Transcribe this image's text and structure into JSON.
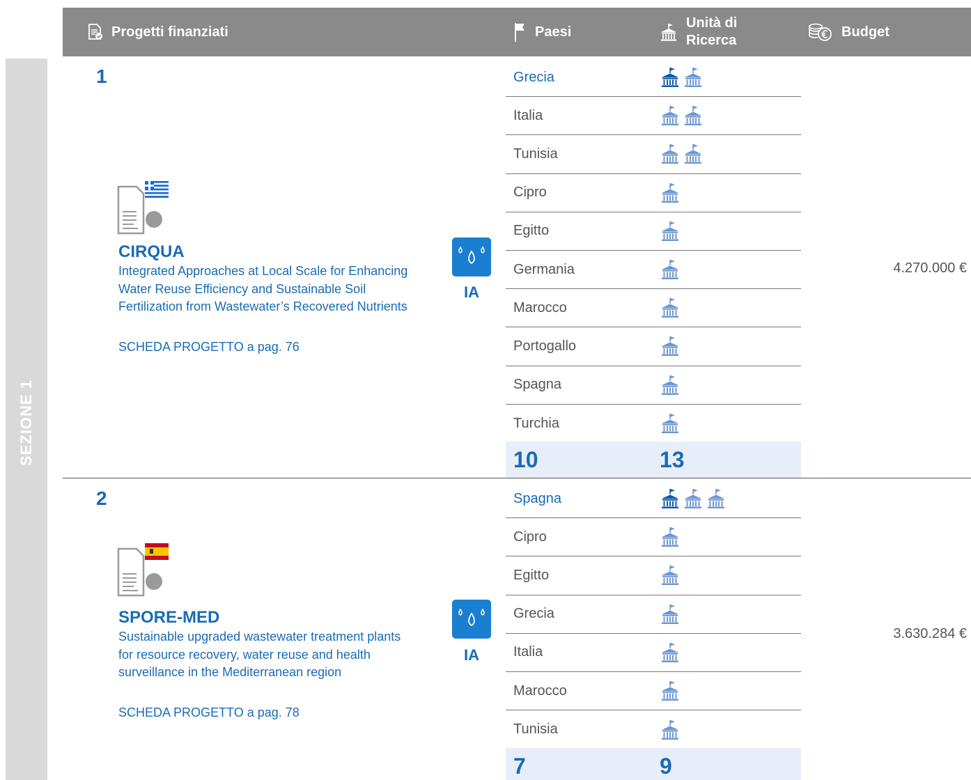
{
  "header": {
    "projects_label": "Progetti finanziati",
    "countries_label": "Paesi",
    "units_label_line1": "Unità di",
    "units_label_line2": "Ricerca",
    "budget_label": "Budget"
  },
  "section_label": "SEZIONE 1",
  "projects": [
    {
      "number": "1",
      "name": "CIRQUA",
      "description": "Integrated Approaches at Local Scale for Enhancing Water Reuse Efficiency and Sustainable Soil Fertilization from Wastewater’s Recovered Nutrients",
      "link": "SCHEDA PROGETTO a pag. 76",
      "type": "IA",
      "flag": "greece-flag",
      "budget": "4.270.000 €",
      "countries": [
        {
          "name": "Grecia",
          "units": 2,
          "lead": true
        },
        {
          "name": "Italia",
          "units": 2,
          "lead": false
        },
        {
          "name": "Tunisia",
          "units": 2,
          "lead": false
        },
        {
          "name": "Cipro",
          "units": 1,
          "lead": false
        },
        {
          "name": "Egitto",
          "units": 1,
          "lead": false
        },
        {
          "name": "Germania",
          "units": 1,
          "lead": false
        },
        {
          "name": "Marocco",
          "units": 1,
          "lead": false
        },
        {
          "name": "Portogallo",
          "units": 1,
          "lead": false
        },
        {
          "name": "Spagna",
          "units": 1,
          "lead": false
        },
        {
          "name": "Turchia",
          "units": 1,
          "lead": false
        }
      ],
      "total_countries": "10",
      "total_units": "13"
    },
    {
      "number": "2",
      "name": "SPORE-MED",
      "description": "Sustainable upgraded wastewater treatment plants for resource recovery, water reuse and health surveillance in the Mediterranean region",
      "link": "SCHEDA PROGETTO a pag. 78",
      "type": "IA",
      "flag": "spain-flag",
      "budget": "3.630.284 €",
      "countries": [
        {
          "name": "Spagna",
          "units": 3,
          "lead": true
        },
        {
          "name": "Cipro",
          "units": 1,
          "lead": false
        },
        {
          "name": "Egitto",
          "units": 1,
          "lead": false
        },
        {
          "name": "Grecia",
          "units": 1,
          "lead": false
        },
        {
          "name": "Italia",
          "units": 1,
          "lead": false
        },
        {
          "name": "Marocco",
          "units": 1,
          "lead": false
        },
        {
          "name": "Tunisia",
          "units": 1,
          "lead": false
        }
      ],
      "total_countries": "7",
      "total_units": "9"
    }
  ],
  "colors": {
    "header_bg": "#8a8a8a",
    "accent_blue": "#1a6bb5",
    "icon_blue": "#1a7fd0",
    "institution_light": "#6b97d3",
    "institution_dark": "#0f5aa6",
    "totals_bg": "#e8eef9",
    "side_bar": "#d9d9d9"
  }
}
